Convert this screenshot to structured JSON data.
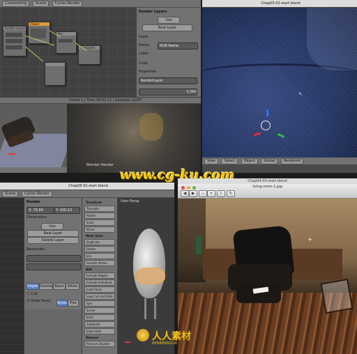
{
  "q1": {
    "header_left": "Compositing",
    "header_scene": "Scene",
    "header_engine": "Cycles Render",
    "nodes": [
      "Render Layers",
      "Viewer",
      "Mix",
      "Composite"
    ],
    "panel_title": "Render Layers",
    "panel_rows": [
      "Layer",
      "RenderLayer",
      "Use Nodes"
    ],
    "panel_fields": {
      "name": "RGB Name",
      "value": "0.000"
    },
    "panel_buttons": [
      "Use",
      "New Layer"
    ],
    "panel_labels": [
      "Name",
      "Label",
      "Color",
      "Properties"
    ],
    "preview_title": "Frame 1 | Time 00:01:11 | Samples 12/50",
    "preview_footer": "Blender Render"
  },
  "q2": {
    "window_title": "Chap05-02-start.blend",
    "view_label": "User Persp",
    "footer_items": [
      "View",
      "Select",
      "Object",
      "Global",
      "Rendered"
    ],
    "side_label": "Properties"
  },
  "watermark": {
    "text": "www.cg-ku.com",
    "color": "#f2c400"
  },
  "q3": {
    "window_title": "Chap05-01-start.blend",
    "header_scene": "Scene",
    "header_engine": "Cycles Render",
    "props": {
      "header": "Render",
      "res_label": "Resolution",
      "res_x": "75.84",
      "res_y": "100.12",
      "sub_panel": "Dimensions",
      "fields": [
        "X:",
        "Y:"
      ],
      "buttons": [
        "Use",
        "New Layer",
        "Delete Layer"
      ],
      "checks": [
        "Display",
        "Overlap",
        "Black",
        "White"
      ],
      "toggles": [
        "Cull",
        "Draw Faces",
        "Smooth",
        "Flat"
      ]
    },
    "tools": [
      "Translate",
      "Rotate",
      "Scale",
      "Mirror",
      "Duplicate",
      "Delete",
      "Join",
      "Smooth Vertex",
      "Extrude Region",
      "Extrude Individual",
      "Inset Faces",
      "Loop Cut and Slide",
      "Spin",
      "Screw",
      "Knife",
      "Subdivide",
      "Edge Slide",
      "Remove Doubles"
    ],
    "tool_sections": [
      "Transform",
      "Mesh Tools",
      "Deform",
      "Add",
      "Remove"
    ],
    "view_label": "User Persp",
    "footer_items": [
      "View",
      "Select",
      "Mesh",
      "Edit Mode"
    ]
  },
  "q4": {
    "app_title": "Chap04-03-start.blend",
    "image_title": "living-room-1.jpg",
    "toolbar_icons": [
      "back-icon",
      "forward-icon",
      "zoom-out-icon",
      "zoom-in-icon",
      "share-icon",
      "rotate-icon"
    ]
  },
  "bottom_watermark": {
    "text": "人人素材",
    "sub": "RENRENSUCAI"
  }
}
